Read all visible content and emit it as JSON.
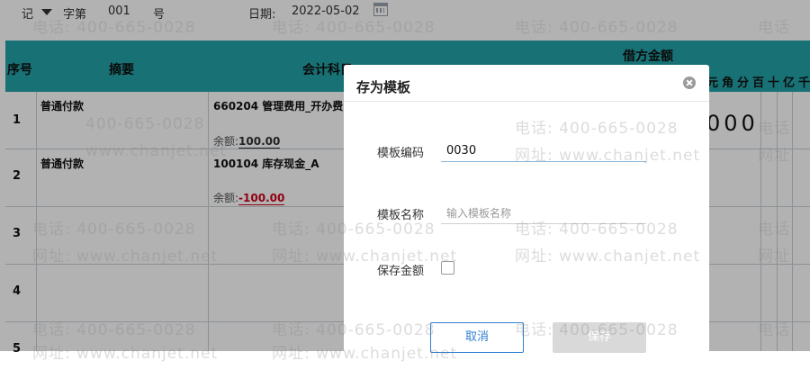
{
  "voucher": {
    "type_label": "记",
    "word_label": "字第",
    "number": "001",
    "number_suffix": "号",
    "date_label": "日期:",
    "date_value": "2022-05-02"
  },
  "table": {
    "headers": {
      "index": "序号",
      "summary": "摘要",
      "account": "会计科目",
      "debit": "借方金额"
    },
    "digit_units": [
      "元",
      "角",
      "分",
      "百",
      "十",
      "亿",
      "千"
    ],
    "rows": [
      {
        "index": "1",
        "summary": "普通付款",
        "account": "660204 管理费用_开办费",
        "balance_label": "余额:",
        "balance": "100.00",
        "balance_negative": false
      },
      {
        "index": "2",
        "summary": "普通付款",
        "account": "100104 库存现金_A",
        "balance_label": "余额:",
        "balance": "-100.00",
        "balance_negative": true
      },
      {
        "index": "3"
      },
      {
        "index": "4"
      },
      {
        "index": "5"
      }
    ],
    "row1_amount": "000"
  },
  "watermark": {
    "phone": "电话: 400-665-0028",
    "site": "网址: www.chanjet.net",
    "phone_partial": "400-665-0028",
    "site_partial": "www.chanjet.net",
    "fragment_tel": "电话",
    "fragment_web": "网址"
  },
  "dialog": {
    "title": "存为模板",
    "code_label": "模板编码",
    "code_value": "0030",
    "name_label": "模板名称",
    "name_placeholder": "输入模板名称",
    "save_amount_label": "保存金额",
    "cancel_label": "取消",
    "save_label": "保存"
  },
  "colors": {
    "header_teal": "#23a3a8",
    "negative_red": "#d0021b",
    "accent_blue": "#2f7fd0"
  },
  "icons": {
    "calendar": "calendar-icon",
    "close": "close-icon",
    "dropdown": "caret-down-icon"
  }
}
